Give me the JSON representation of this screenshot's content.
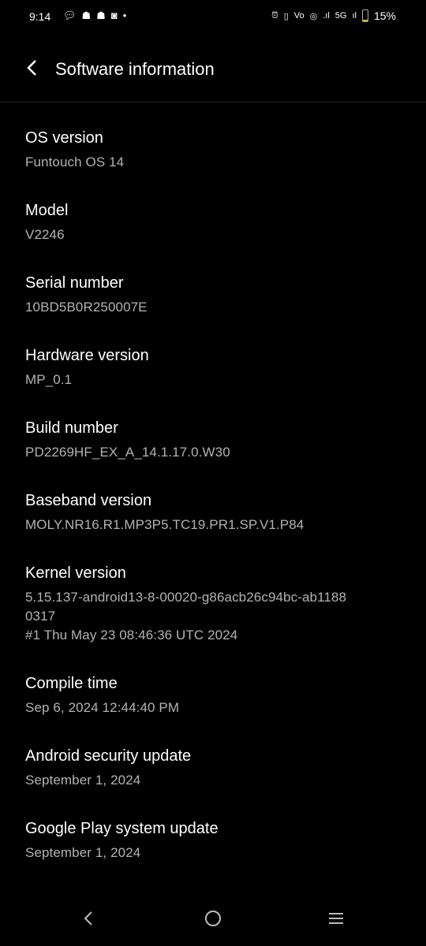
{
  "status_bar": {
    "time": "9:14",
    "notification_icons": [
      "chat-icon",
      "snapchat-icon",
      "snapchat-icon",
      "instagram-icon",
      "dot-icon"
    ],
    "right_icons": [
      "alarm-icon",
      "vibrate-icon",
      "volte-icon",
      "hotspot-icon",
      "signal-icon",
      "network-icon",
      "signal-icon"
    ],
    "network": "5G",
    "battery": "15%",
    "battery_level": 15,
    "battery_color": "#e3b400"
  },
  "header": {
    "title": "Software information"
  },
  "items": [
    {
      "label": "OS version",
      "value": "Funtouch OS 14"
    },
    {
      "label": "Model",
      "value": "V2246"
    },
    {
      "label": "Serial number",
      "value": "10BD5B0R250007E"
    },
    {
      "label": "Hardware version",
      "value": "MP_0.1"
    },
    {
      "label": "Build number",
      "value": "PD2269HF_EX_A_14.1.17.0.W30"
    },
    {
      "label": "Baseband version",
      "value": "MOLY.NR16.R1.MP3P5.TC19.PR1.SP.V1.P84"
    },
    {
      "label": "Kernel version",
      "value": "5.15.137-android13-8-00020-g86acb26c94bc-ab1188\n0317\n#1 Thu May 23 08:46:36 UTC 2024"
    },
    {
      "label": "Compile time",
      "value": "Sep 6, 2024 12:44:40 PM"
    },
    {
      "label": "Android security update",
      "value": "September 1, 2024"
    },
    {
      "label": "Google Play system update",
      "value": "September 1, 2024"
    }
  ]
}
